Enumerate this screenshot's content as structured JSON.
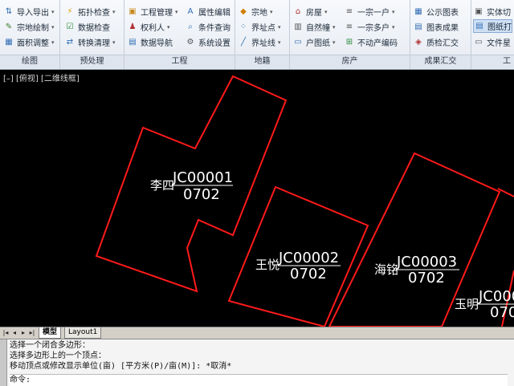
{
  "ribbon": {
    "groups": [
      {
        "label": "绘图",
        "items": [
          "导入导出",
          "宗地绘制",
          "面积调整"
        ]
      },
      {
        "label": "预处理",
        "items": [
          "拓扑检查",
          "数据检查",
          "转换清理"
        ]
      },
      {
        "label": "工程",
        "items": [
          "工程管理",
          "权利人",
          "数据导航",
          "属性编辑",
          "条件查询",
          "系统设置"
        ]
      },
      {
        "label": "地籍",
        "items": [
          "宗地",
          "界址点",
          "界址线"
        ]
      },
      {
        "label": "房产",
        "items": [
          "房屋",
          "自然幢",
          "户图纸",
          "一宗一户",
          "一宗多户",
          "不动产编码"
        ]
      },
      {
        "label": "成果汇交",
        "items": [
          "公示图表",
          "图表成果",
          "质检汇交"
        ]
      },
      {
        "label": "工",
        "items": [
          "实体切",
          "图纸打",
          "文件星"
        ]
      }
    ]
  },
  "canvas": {
    "viewport_label": "[–] [俯视] [二维线框]",
    "parcels": [
      {
        "owner": "李四",
        "code": "JC00001",
        "area": "0702"
      },
      {
        "owner": "王悦",
        "code": "JC00002",
        "area": "0702"
      },
      {
        "owner": "海铭",
        "code": "JC00003",
        "area": "0702"
      },
      {
        "owner": "玉明",
        "code": "JC0000",
        "area": "070"
      }
    ]
  },
  "layout_tabs": {
    "model": "模型",
    "layout1": "Layout1"
  },
  "command": {
    "lines": [
      "选择一个闭合多边形：",
      "选择多边形上的一个顶点：",
      "移动顶点或修改显示单位(亩) [平方米(P)/亩(M)]: *取消*"
    ],
    "prompt": "命令:"
  },
  "colors": {
    "parcel": "#ff1a1a",
    "text": "#ffffff",
    "background": "#000000"
  }
}
